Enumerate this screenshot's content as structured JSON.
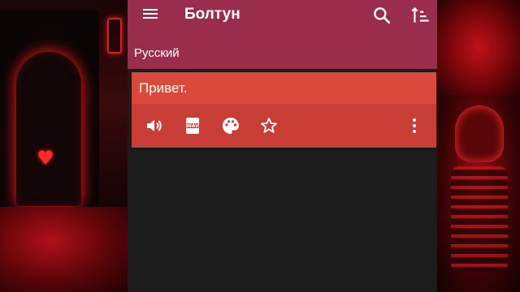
{
  "app": {
    "title": "Болтун",
    "language": "Русский"
  },
  "toolbar": {
    "menu_icon": "hamburger-menu-icon",
    "search_icon": "search-icon",
    "sort_icon": "sort-icon"
  },
  "phrase_card": {
    "text": "Привет.",
    "actions": [
      {
        "icon": "speaker-icon"
      },
      {
        "icon": "wav-file-icon",
        "label": "WAV"
      },
      {
        "icon": "palette-icon"
      },
      {
        "icon": "star-outline-icon"
      },
      {
        "icon": "more-vert-icon"
      }
    ]
  },
  "colors": {
    "toolbar": "#9a2d4c",
    "card": "#da4a3c",
    "card_actions": "#c83d35",
    "app_background": "#1c1c1c"
  }
}
